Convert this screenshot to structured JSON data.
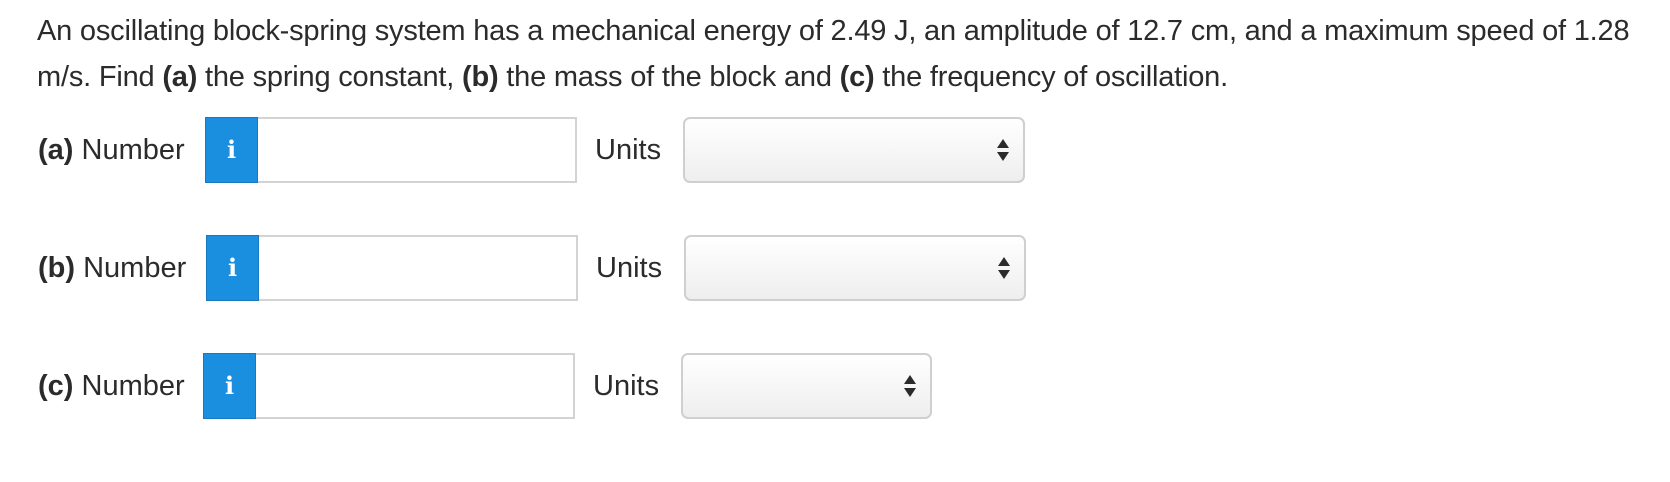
{
  "question": {
    "intro": "An oscillating block-spring system has a mechanical energy of 2.49 J, an amplitude of 12.7 cm, and a maximum speed of 1.28 m/s. Find ",
    "part_a_tag": "(a)",
    "part_a_text": " the spring constant, ",
    "part_b_tag": "(b)",
    "part_b_text": " the mass of the block and ",
    "part_c_tag": "(c)",
    "part_c_text": " the frequency of oscillation."
  },
  "rows": [
    {
      "tag": "(a)",
      "number_label": " Number",
      "info_icon": "i",
      "number_value": "",
      "units_label": "Units",
      "units_value": ""
    },
    {
      "tag": "(b)",
      "number_label": " Number",
      "info_icon": "i",
      "number_value": "",
      "units_label": "Units",
      "units_value": ""
    },
    {
      "tag": "(c)",
      "number_label": " Number",
      "info_icon": "i",
      "number_value": "",
      "units_label": "Units",
      "units_value": ""
    }
  ],
  "colors": {
    "info_button": "#1a8fe0",
    "text": "#2b2b2b",
    "input_border": "#d3d3d3"
  },
  "icons": {
    "info": "info-icon",
    "select_arrows": "updown-arrows-icon"
  }
}
